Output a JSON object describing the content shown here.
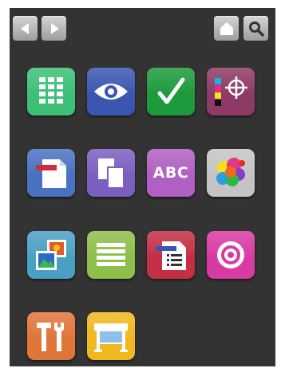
{
  "toolbar": {
    "back_icon": "arrow-left-icon",
    "forward_icon": "arrow-right-icon",
    "home_icon": "home-icon",
    "search_icon": "magnifier-icon"
  },
  "tiles": [
    {
      "icon": "grid-icon",
      "color": "#3dbf78"
    },
    {
      "icon": "eye-icon",
      "color": "#3a56b0"
    },
    {
      "icon": "checkmark-icon",
      "color": "#1d9a3c"
    },
    {
      "icon": "color-registration-icon",
      "color": "#8e3a66"
    },
    {
      "icon": "document-icon",
      "color": "#4a72c2"
    },
    {
      "icon": "pages-icon",
      "color": "#7b5fc0"
    },
    {
      "icon": "text-icon",
      "color": "#b060c2",
      "label": "ABC"
    },
    {
      "icon": "color-palette-icon",
      "color": "#c4c4c4"
    },
    {
      "icon": "images-icon",
      "color": "#4aa0c2"
    },
    {
      "icon": "layers-icon",
      "color": "#8fbe4a"
    },
    {
      "icon": "document-list-icon",
      "color": "#c42f45"
    },
    {
      "icon": "target-icon",
      "color": "#d83aa4"
    },
    {
      "icon": "tools-icon",
      "color": "#e0753a"
    },
    {
      "icon": "printer-icon",
      "color": "#f0b81e"
    }
  ]
}
